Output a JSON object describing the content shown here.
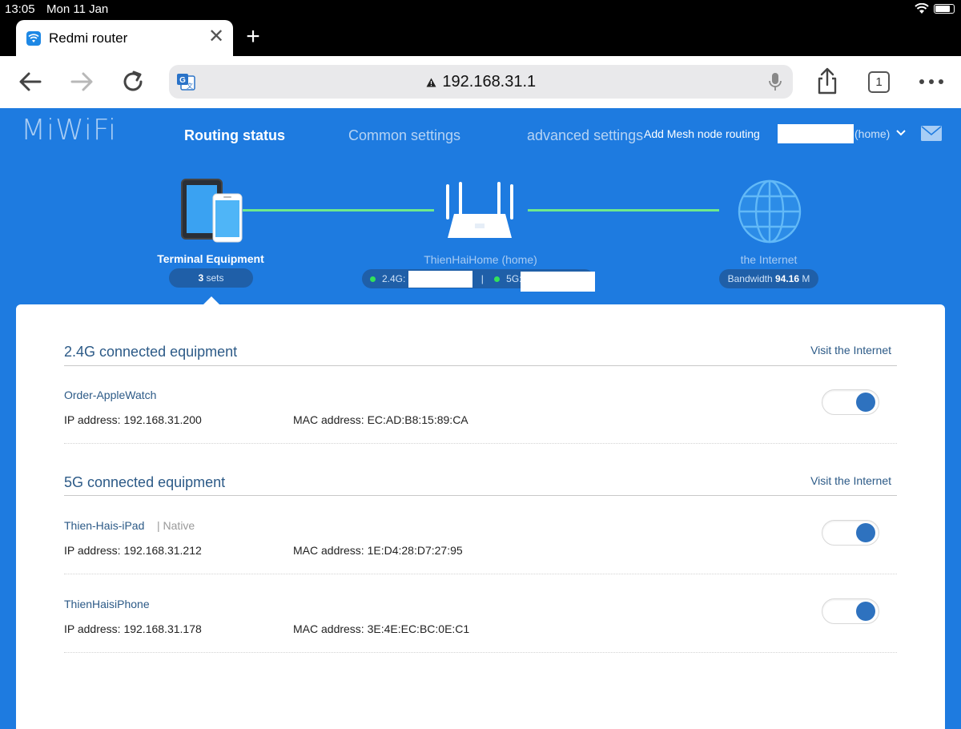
{
  "status_bar": {
    "time": "13:05",
    "date": "Mon 11 Jan"
  },
  "browser": {
    "tab_title": "Redmi router",
    "tab_close": "✕",
    "new_tab": "+",
    "url": "192.168.31.1",
    "tab_count": "1",
    "icons": [
      "back-icon",
      "forward-icon",
      "reload-icon",
      "translate-icon",
      "warning-icon",
      "mic-icon",
      "share-icon",
      "more-icon"
    ]
  },
  "header": {
    "logo": "MiWiFi",
    "nav": [
      "Routing status",
      "Common settings",
      "advanced settings"
    ],
    "mesh_link": "Add Mesh node routing",
    "network_suffix": "(home)"
  },
  "topology": {
    "terminal": {
      "label": "Terminal Equipment",
      "count": "3",
      "count_suffix": "sets"
    },
    "router": {
      "label": "ThienHaiHome (home)",
      "band_24": "2.4G:",
      "separator": "|",
      "band_5": "5G:"
    },
    "internet": {
      "label": "the Internet",
      "bandwidth_label": "Bandwidth",
      "bandwidth_value": "94.16",
      "bandwidth_unit": "M"
    },
    "colors": {
      "link_line": "#6ee98c",
      "status_dot": "#32e25a",
      "background": "#1e7be0"
    }
  },
  "sections": [
    {
      "title": "2.4G connected equipment",
      "link": "Visit the Internet",
      "devices": [
        {
          "name": "Order-AppleWatch",
          "tag": "",
          "ip": "IP address: 192.168.31.200",
          "mac": "MAC address: EC:AD:B8:15:89:CA",
          "enabled": true
        }
      ]
    },
    {
      "title": "5G connected equipment",
      "link": "Visit the Internet",
      "devices": [
        {
          "name": "Thien-Hais-iPad",
          "tag": "| Native",
          "ip": "IP address: 192.168.31.212",
          "mac": "MAC address: 1E:D4:28:D7:27:95",
          "enabled": true
        },
        {
          "name": "ThienHaisiPhone",
          "tag": "",
          "ip": "IP address: 192.168.31.178",
          "mac": "MAC address: 3E:4E:EC:BC:0E:C1",
          "enabled": true
        }
      ]
    }
  ]
}
